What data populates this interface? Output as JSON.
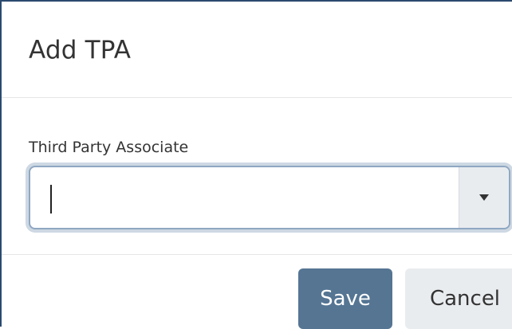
{
  "dialog": {
    "title": "Add TPA",
    "field": {
      "label": "Third Party Associate",
      "value": "",
      "dropdown_icon": "caret-down-icon"
    },
    "buttons": {
      "save_label": "Save",
      "cancel_label": "Cancel"
    }
  },
  "colors": {
    "border": "#2b4a6f",
    "primary_button": "#557593",
    "secondary_button": "#e9ecef",
    "focus_ring": "#cdd8e3",
    "text": "#333333"
  }
}
